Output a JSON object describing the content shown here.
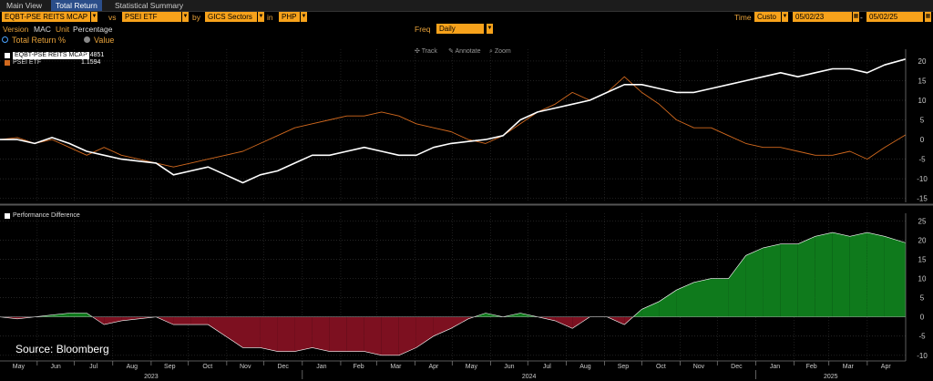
{
  "tabs": [
    {
      "label": "Main View",
      "active": false
    },
    {
      "label": "Total Return",
      "active": true
    },
    {
      "label": "Statistical Summary",
      "active": false
    }
  ],
  "controls": {
    "security": "EQBT-PSE REITS MCAP",
    "vs_label": "vs",
    "benchmark": "PSEI ETF",
    "by_label": "by",
    "grouping": "GICS Sectors",
    "in_label": "in",
    "currency": "PHP",
    "time_label": "Time",
    "time_mode": "Custo",
    "start_date": "05/02/23",
    "date_sep": "-",
    "end_date": "05/02/25",
    "version_label": "Version",
    "version_value": "MAC",
    "unit_label": "Unit",
    "unit_value": "Percentage",
    "freq_label": "Freq",
    "freq_value": "Daily",
    "radio_total_return": "Total Return %",
    "radio_value": "Value"
  },
  "toolbar": {
    "track": "Track",
    "annotate": "Annotate",
    "zoom": "Zoom"
  },
  "legend": {
    "series1_name": "EQBT-PSE REITS MCAP",
    "series1_value": "20.4851",
    "series2_name": "PSEI ETF",
    "series2_value": "1.1594",
    "lower_name": "Performance Difference"
  },
  "source": "Source: Bloomberg",
  "colors": {
    "series1": "#ffffff",
    "series2": "#d2691e",
    "positive": "#0f7a1c",
    "negative": "#7d1020",
    "accent": "#f7a21b"
  },
  "chart_data": {
    "type": "line",
    "upper": {
      "ylim": [
        -16,
        23
      ],
      "yticks": [
        "20",
        "15",
        "10",
        "5",
        "0",
        "-5",
        "-10",
        "-15"
      ],
      "x": [
        "2023-05-02",
        "2023-05-16",
        "2023-05-30",
        "2023-06-13",
        "2023-06-27",
        "2023-07-11",
        "2023-07-25",
        "2023-08-08",
        "2023-08-22",
        "2023-09-05",
        "2023-09-19",
        "2023-10-03",
        "2023-10-17",
        "2023-10-31",
        "2023-11-14",
        "2023-11-28",
        "2023-12-12",
        "2023-12-26",
        "2024-01-09",
        "2024-01-23",
        "2024-02-06",
        "2024-02-20",
        "2024-03-05",
        "2024-03-19",
        "2024-04-02",
        "2024-04-16",
        "2024-04-30",
        "2024-05-14",
        "2024-05-28",
        "2024-06-11",
        "2024-06-25",
        "2024-07-09",
        "2024-07-23",
        "2024-08-06",
        "2024-08-20",
        "2024-09-03",
        "2024-09-17",
        "2024-10-01",
        "2024-10-15",
        "2024-10-29",
        "2024-11-12",
        "2024-11-26",
        "2024-12-10",
        "2024-12-24",
        "2025-01-07",
        "2025-01-21",
        "2025-02-04",
        "2025-02-18",
        "2025-03-04",
        "2025-03-18",
        "2025-04-01",
        "2025-04-15",
        "2025-05-02"
      ],
      "series": [
        {
          "name": "EQBT-PSE REITS MCAP",
          "values": [
            0,
            0,
            -1,
            0.5,
            -1,
            -3,
            -4,
            -5,
            -5.5,
            -6,
            -9,
            -8,
            -7,
            -9,
            -11,
            -9,
            -8,
            -6,
            -4,
            -4,
            -3,
            -2,
            -3,
            -4,
            -4,
            -2,
            -1,
            -0.5,
            0,
            1,
            5,
            7,
            8,
            9,
            10,
            12,
            14,
            14,
            13,
            12,
            12,
            13,
            14,
            15,
            16,
            17,
            16,
            17,
            18,
            18,
            17,
            19,
            20.5
          ]
        },
        {
          "name": "PSEI ETF",
          "values": [
            0,
            0.5,
            -1,
            0,
            -2,
            -4,
            -2,
            -4,
            -5,
            -6,
            -7,
            -6,
            -5,
            -4,
            -3,
            -1,
            1,
            3,
            4,
            5,
            6,
            6,
            7,
            6,
            4,
            3,
            2,
            0,
            -1,
            1,
            4,
            7,
            9,
            12,
            10,
            12,
            16,
            12,
            9,
            5,
            3,
            3,
            1,
            -1,
            -2,
            -2,
            -3,
            -4,
            -4,
            -3,
            -5,
            -2,
            1.2
          ]
        }
      ]
    },
    "lower": {
      "ylim": [
        -11,
        27
      ],
      "yticks": [
        "25",
        "20",
        "15",
        "10",
        "5",
        "0",
        "-5",
        "-10"
      ],
      "name": "Performance Difference",
      "values": [
        0,
        -0.5,
        0,
        0.5,
        1,
        1,
        -2,
        -1,
        -0.5,
        0,
        -2,
        -2,
        -2,
        -5,
        -8,
        -8,
        -9,
        -9,
        -8,
        -9,
        -9,
        -9,
        -10,
        -10,
        -8,
        -5,
        -3,
        -0.5,
        1,
        0,
        1,
        0,
        -1,
        -3,
        0,
        0,
        -2,
        2,
        4,
        7,
        9,
        10,
        10,
        16,
        18,
        19,
        19,
        21,
        22,
        21,
        22,
        21,
        19.3
      ]
    },
    "month_ticks": [
      "May",
      "Jun",
      "Jul",
      "Aug",
      "Sep",
      "Oct",
      "Nov",
      "Dec",
      "Jan",
      "Feb",
      "Mar",
      "Apr",
      "May",
      "Jun",
      "Jul",
      "Aug",
      "Sep",
      "Oct",
      "Nov",
      "Dec",
      "Jan",
      "Feb",
      "Mar",
      "Apr"
    ],
    "year_ticks": [
      "2023",
      "2024",
      "2025"
    ],
    "grid": true
  }
}
